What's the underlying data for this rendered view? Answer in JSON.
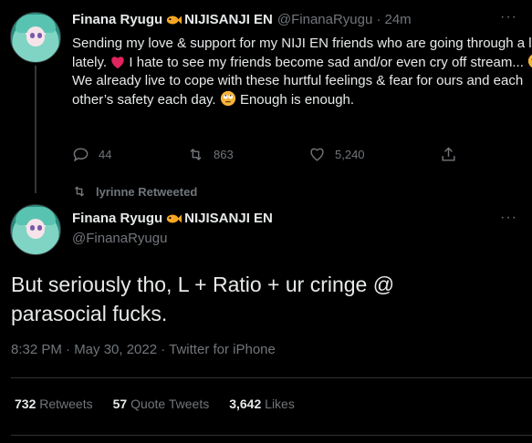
{
  "tweet1": {
    "name": "Finana Ryugu",
    "org": "NIJISANJI EN",
    "handle": "@FinanaRyugu",
    "time": "· 24m",
    "text_part1": "Sending my love & support for my NIJI EN friends who are going through a lot lately.",
    "text_part2": "I hate to see my friends become sad and/or even cry off stream...",
    "text_part3": "We already live to cope with these hurtful feelings & fear for ours and each other’s safety each day.",
    "text_part4": "Enough is enough.",
    "replies": "44",
    "retweets": "863",
    "likes": "5,240",
    "more": "···"
  },
  "retweeted_by": "lyrinne Retweeted",
  "tweet2": {
    "name": "Finana Ryugu",
    "org": "NIJISANJI EN",
    "handle": "@FinanaRyugu",
    "text": "But seriously tho, L + Ratio + ur cringe @ parasocial fucks.",
    "meta": "8:32 PM · May 30, 2022 · Twitter for iPhone",
    "more": "···",
    "stats": {
      "retweets_count": "732",
      "retweets_label": "Retweets",
      "quotes_count": "57",
      "quotes_label": "Quote Tweets",
      "likes_count": "3,642",
      "likes_label": "Likes"
    }
  },
  "colors": {
    "background": "#000000",
    "text": "#e7e9ea",
    "muted": "#71767b",
    "divider": "#2f3336",
    "heart": "#e0245e"
  }
}
